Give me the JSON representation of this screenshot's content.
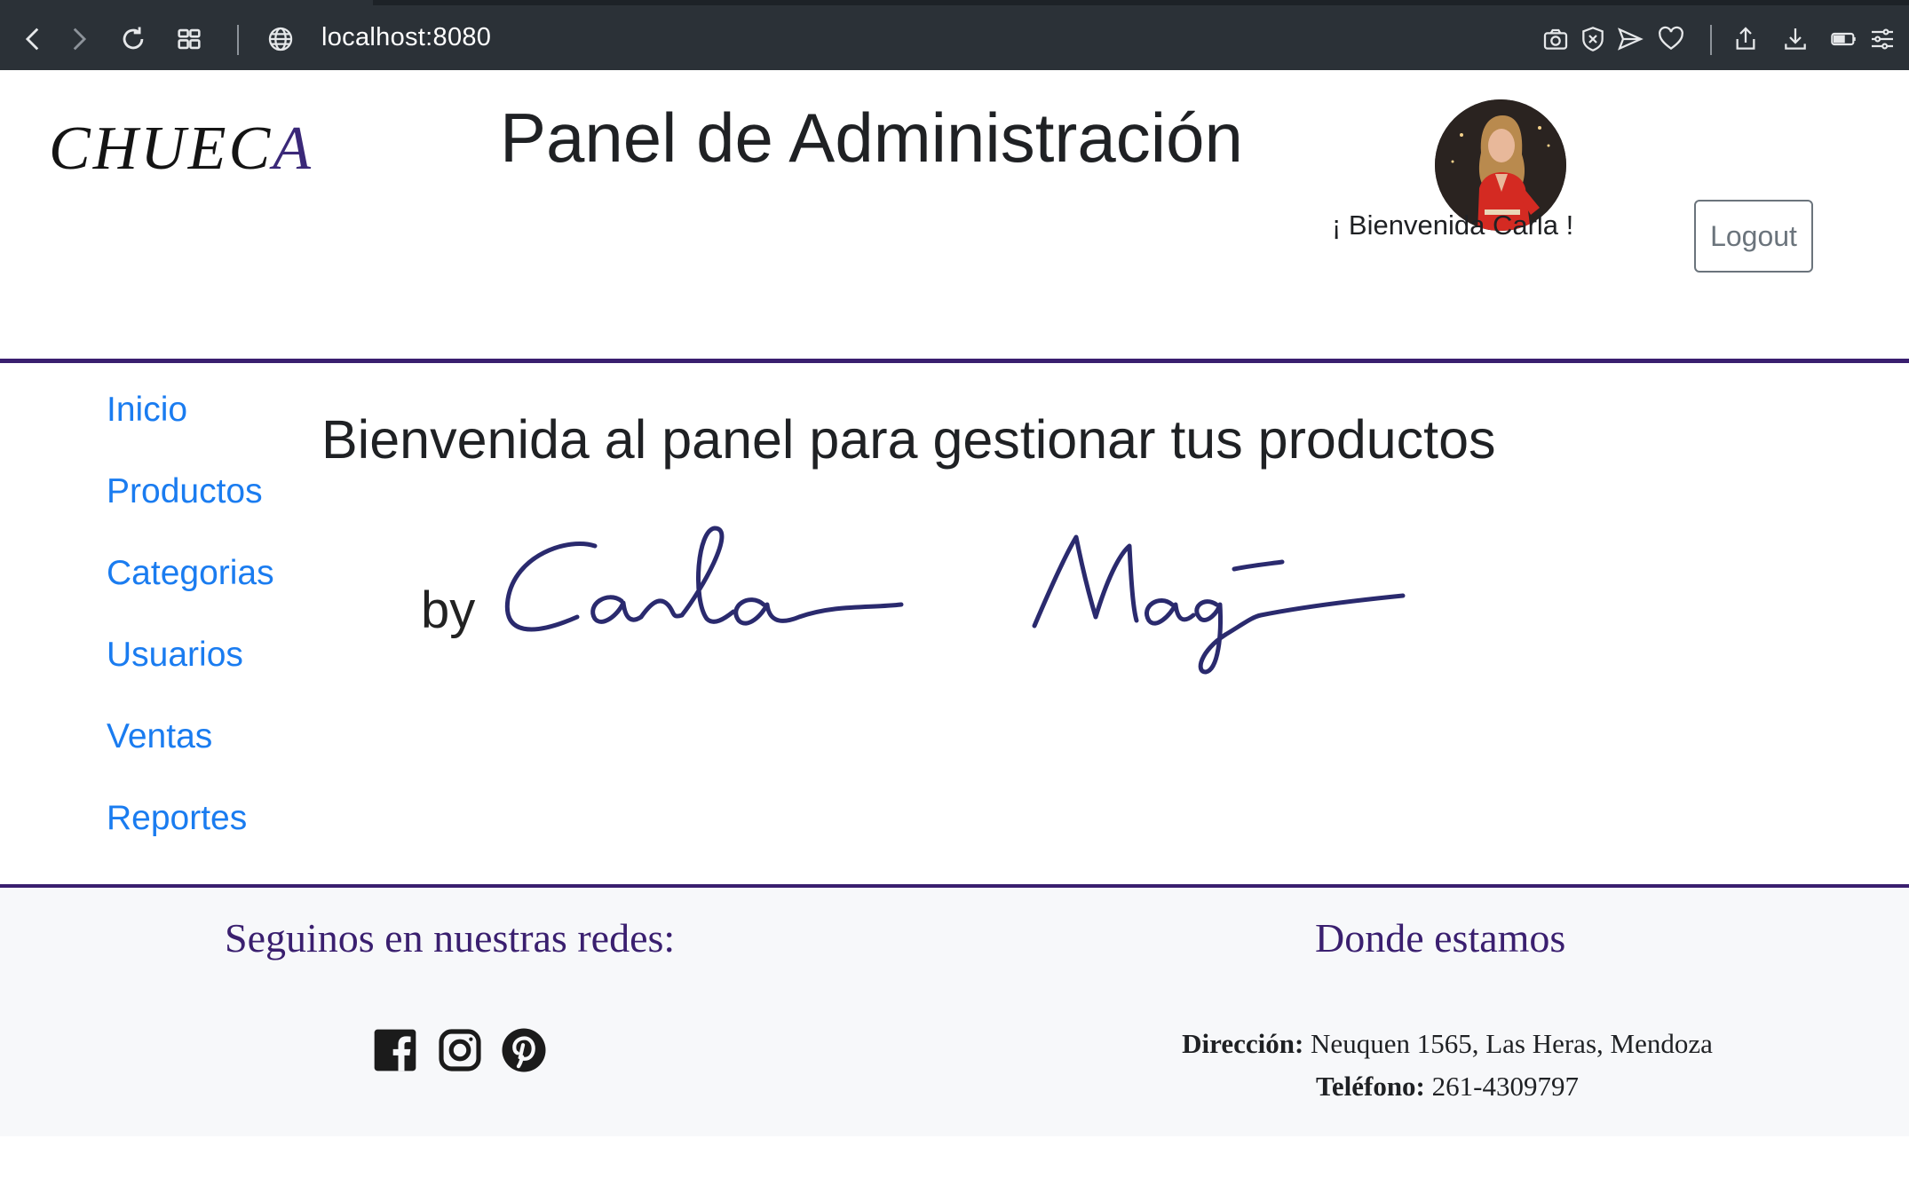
{
  "browser": {
    "url": "localhost:8080",
    "icons": [
      "back-icon",
      "forward-icon",
      "reload-icon",
      "tabs-grid-icon",
      "globe-icon",
      "camera-icon",
      "shield-icon",
      "send-icon",
      "heart-icon",
      "share-icon",
      "download-icon",
      "battery-icon",
      "menu-icon"
    ]
  },
  "header": {
    "logo_main": "CHUEC",
    "logo_last": "A",
    "title": "Panel de Administración",
    "welcome": "¡ Bienvenida Carla !",
    "logout_label": "Logout"
  },
  "sidebar": {
    "items": [
      {
        "label": "Inicio"
      },
      {
        "label": "Productos"
      },
      {
        "label": "Categorias"
      },
      {
        "label": "Usuarios"
      },
      {
        "label": "Ventas"
      },
      {
        "label": "Reportes"
      }
    ]
  },
  "main": {
    "heading": "Bienvenida al panel para gestionar tus productos",
    "signature_by": "by",
    "signature_name": "Carla Magi"
  },
  "footer": {
    "social_heading": "Seguinos en nuestras redes:",
    "location_heading": "Donde estamos",
    "address_label": "Dirección:",
    "address_value": "Neuquen 1565, Las Heras, Mendoza",
    "phone_label": "Teléfono:",
    "phone_value": "261-4309797"
  },
  "colors": {
    "brand_purple": "#3a1f6f",
    "link_blue": "#1a7cf0",
    "chrome_bg": "#2b3137"
  }
}
